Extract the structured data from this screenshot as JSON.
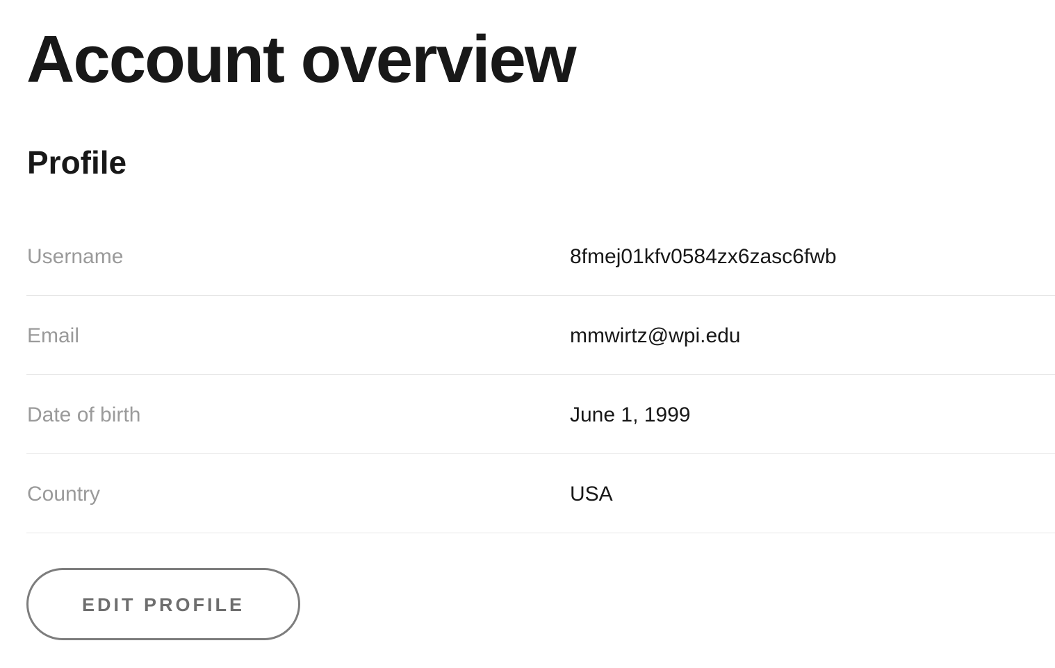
{
  "page": {
    "title": "Account overview"
  },
  "profile": {
    "section_title": "Profile",
    "rows": [
      {
        "label": "Username",
        "value": "8fmej01kfv0584zx6zasc6fwb"
      },
      {
        "label": "Email",
        "value": "mmwirtz@wpi.edu"
      },
      {
        "label": "Date of birth",
        "value": "June 1, 1999"
      },
      {
        "label": "Country",
        "value": "USA"
      }
    ],
    "edit_button_label": "EDIT PROFILE"
  },
  "colors": {
    "heading": "#181818",
    "label": "#9a9a9a",
    "divider": "#e6e6e6",
    "button_border": "#7d7d7d",
    "button_text": "#6e6e6e",
    "background": "#ffffff"
  }
}
